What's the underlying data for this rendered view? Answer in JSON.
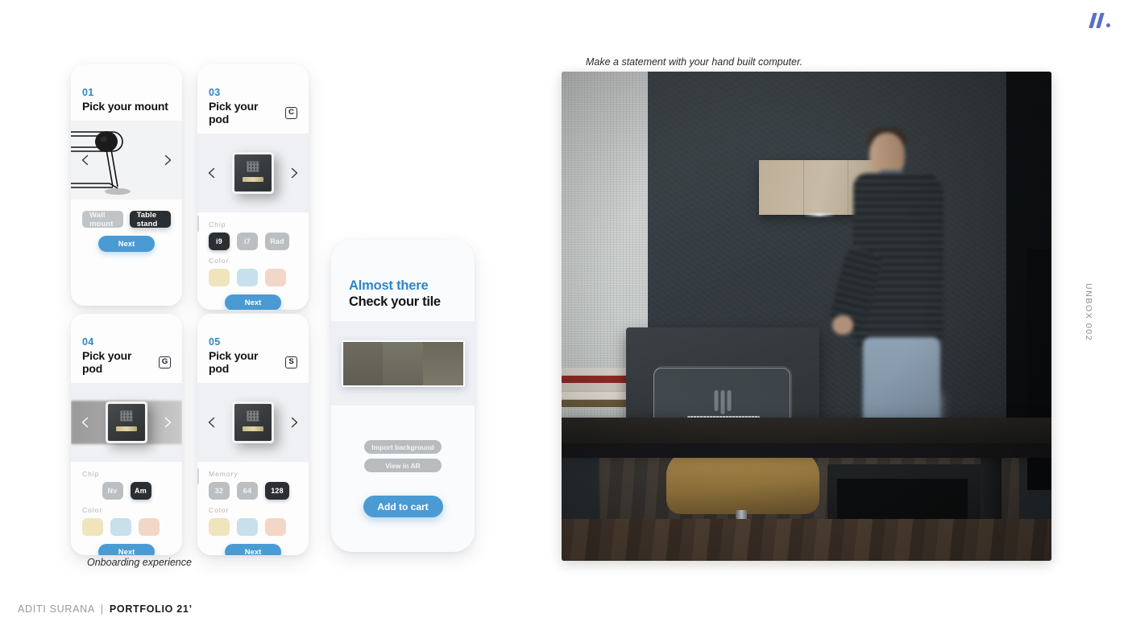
{
  "brand": {
    "mark_name": "slash-logo"
  },
  "side_label": "UNBOX 002",
  "footer": {
    "author": "ADITI SURANA",
    "separator": "|",
    "title": "PORTFOLIO 21’"
  },
  "captions": {
    "onboarding": "Onboarding experience",
    "photo": "Make a statement with your hand built computer."
  },
  "cards": [
    {
      "id": "card-01-mount",
      "step": "01",
      "title": "Pick your mount",
      "badge": "",
      "arrows": {
        "prev": "‹",
        "next": "›"
      },
      "pills": [
        {
          "label": "Wall mount",
          "selected": false
        },
        {
          "label": "Table stand",
          "selected": true
        }
      ],
      "next_label": "Next"
    },
    {
      "id": "card-03-pod-c",
      "step": "03",
      "title": "Pick your pod",
      "badge": "C",
      "arrows": {
        "prev": "‹",
        "next": "›"
      },
      "groups": [
        {
          "label": "Chip",
          "options": [
            {
              "label": "i9",
              "selected": true
            },
            {
              "label": "i7",
              "selected": false
            },
            {
              "label": "Rad",
              "selected": false
            }
          ]
        }
      ],
      "color_label": "Color",
      "colors": [
        "#f0e4bd",
        "#c7e0ec",
        "#f2d7c7"
      ],
      "next_label": "Next"
    },
    {
      "id": "card-04-pod-g",
      "step": "04",
      "title": "Pick your pod",
      "badge": "G",
      "arrows": {
        "prev": "‹",
        "next": "›"
      },
      "groups": [
        {
          "label": "Chip",
          "options": [
            {
              "label": "Nv",
              "selected": false
            },
            {
              "label": "Am",
              "selected": true
            }
          ]
        }
      ],
      "color_label": "Color",
      "colors": [
        "#f0e4bd",
        "#c7e0ec",
        "#f2d7c7"
      ],
      "next_label": "Next"
    },
    {
      "id": "card-05-pod-s",
      "step": "05",
      "title": "Pick your pod",
      "badge": "S",
      "arrows": {
        "prev": "‹",
        "next": "›"
      },
      "groups": [
        {
          "label": "Memory",
          "options": [
            {
              "label": "32",
              "selected": false
            },
            {
              "label": "64",
              "selected": false
            },
            {
              "label": "128",
              "selected": true
            }
          ]
        }
      ],
      "color_label": "Color",
      "colors": [
        "#f0e4bd",
        "#c7e0ec",
        "#f2d7c7"
      ],
      "next_label": "Next"
    }
  ],
  "summary_card": {
    "id": "card-summary-tile",
    "eyebrow": "Almost there",
    "heading": "Check your tile",
    "secondary_buttons": [
      "Import background",
      "View in AR"
    ],
    "primary_button": "Add to cart"
  },
  "colors": {
    "accent_blue": "#4a9ad4",
    "step_blue": "#2e86c8",
    "dark_chip": "#2b2f34",
    "muted_chip": "#bcbfc2",
    "logo_purple": "#5b6fc4"
  }
}
